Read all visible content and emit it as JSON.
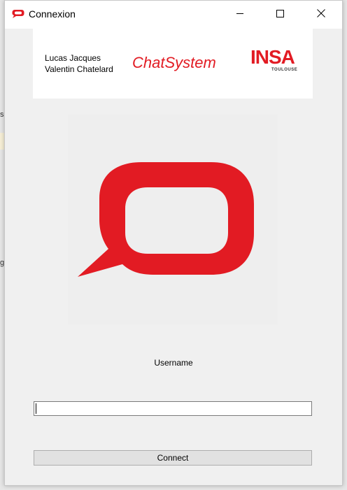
{
  "background": {
    "left_fragments": [
      "s",
      "g"
    ]
  },
  "window": {
    "title": "Connexion",
    "controls": {
      "minimize_icon": "minimize-icon",
      "maximize_icon": "maximize-icon",
      "close_icon": "close-icon"
    }
  },
  "header": {
    "authors": [
      "Lucas Jacques",
      "Valentin Chatelard"
    ],
    "brand": "ChatSystem",
    "school_logo": {
      "word": "INSA",
      "sub": "TOULOUSE"
    }
  },
  "logo": {
    "icon": "chat-bubble-logo-icon"
  },
  "form": {
    "username_label": "Username",
    "username_value": "",
    "connect_label": "Connect"
  },
  "colors": {
    "accent": "#e21b23",
    "window_bg": "#f0f0f0",
    "panel_bg": "#ffffff"
  }
}
